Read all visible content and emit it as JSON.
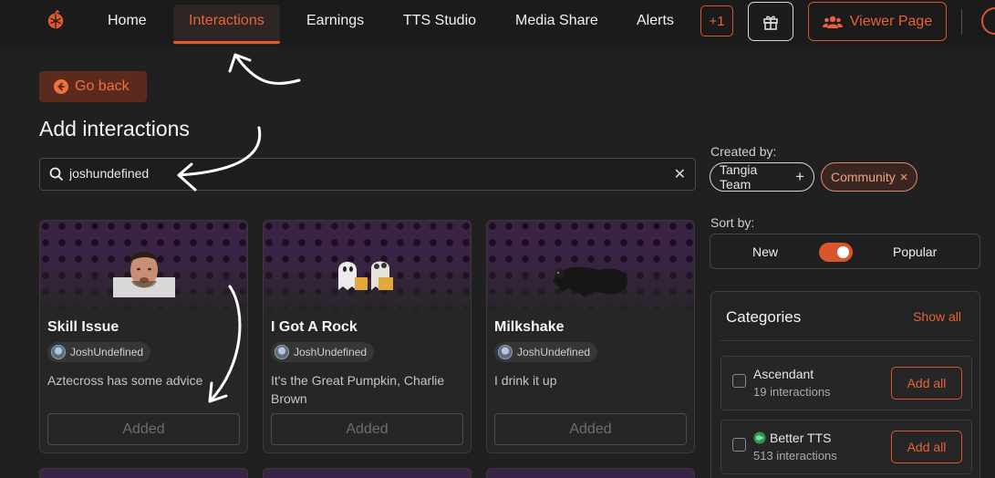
{
  "nav": {
    "items": [
      {
        "label": "Home"
      },
      {
        "label": "Interactions"
      },
      {
        "label": "Earnings"
      },
      {
        "label": "TTS Studio"
      },
      {
        "label": "Media Share"
      },
      {
        "label": "Alerts"
      }
    ],
    "plus_badge": "+1",
    "viewer_page": "Viewer Page"
  },
  "go_back": "Go back",
  "page_title": "Add interactions",
  "search": {
    "value": "joshundefined"
  },
  "cards": [
    {
      "title": "Skill Issue",
      "author": "JoshUndefined",
      "description": "Aztecross has some advice",
      "button": "Added"
    },
    {
      "title": "I Got A Rock",
      "author": "JoshUndefined",
      "description": "It's the Great Pumpkin, Charlie Brown",
      "button": "Added"
    },
    {
      "title": "Milkshake",
      "author": "JoshUndefined",
      "description": "I drink it up",
      "button": "Added"
    }
  ],
  "filters": {
    "created_by_label": "Created by:",
    "chips": [
      {
        "label": "Tangia Team",
        "symbol": "+"
      },
      {
        "label": "Community",
        "symbol": "×"
      }
    ],
    "sort_label": "Sort by:",
    "sort_new": "New",
    "sort_popular": "Popular",
    "sort_toggle_on": true
  },
  "categories": {
    "title": "Categories",
    "show_all": "Show all",
    "items": [
      {
        "name": "Ascendant",
        "count": "19 interactions",
        "button": "Add all"
      },
      {
        "name": "Better TTS",
        "count": "513 interactions",
        "button": "Add all"
      }
    ]
  },
  "colors": {
    "accent": "#e05a2b",
    "background": "#202020",
    "card_pattern": "#3a2344"
  }
}
